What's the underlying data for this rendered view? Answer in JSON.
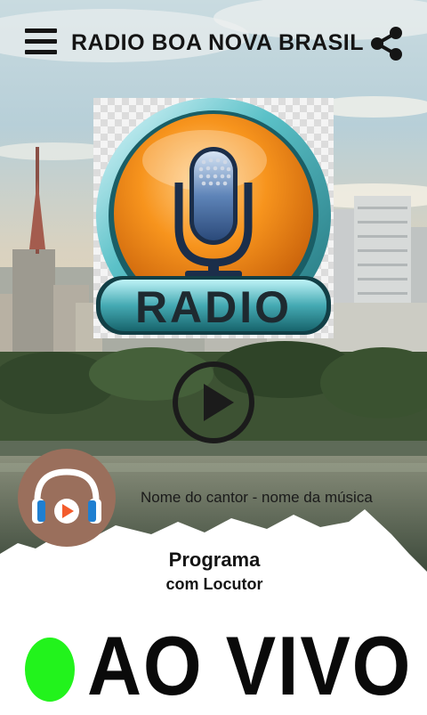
{
  "header": {
    "title": "RADIO BOA NOVA BRASIL",
    "menu_icon": "hamburger-menu-icon",
    "share_icon": "share-icon"
  },
  "logo": {
    "text": "RADIO",
    "icon": "microphone-icon",
    "colors": {
      "orange": "#f7941d",
      "teal": "#3aa0a8",
      "dark": "#1e2a30"
    }
  },
  "player": {
    "play_icon": "play-icon",
    "song": "Nome do cantor - nome da música",
    "album_icon": "headphones-icon",
    "program": "Programa",
    "host": "com Locutor"
  },
  "live": {
    "label": "AO VIVO",
    "indicator_color": "#22f31c"
  }
}
